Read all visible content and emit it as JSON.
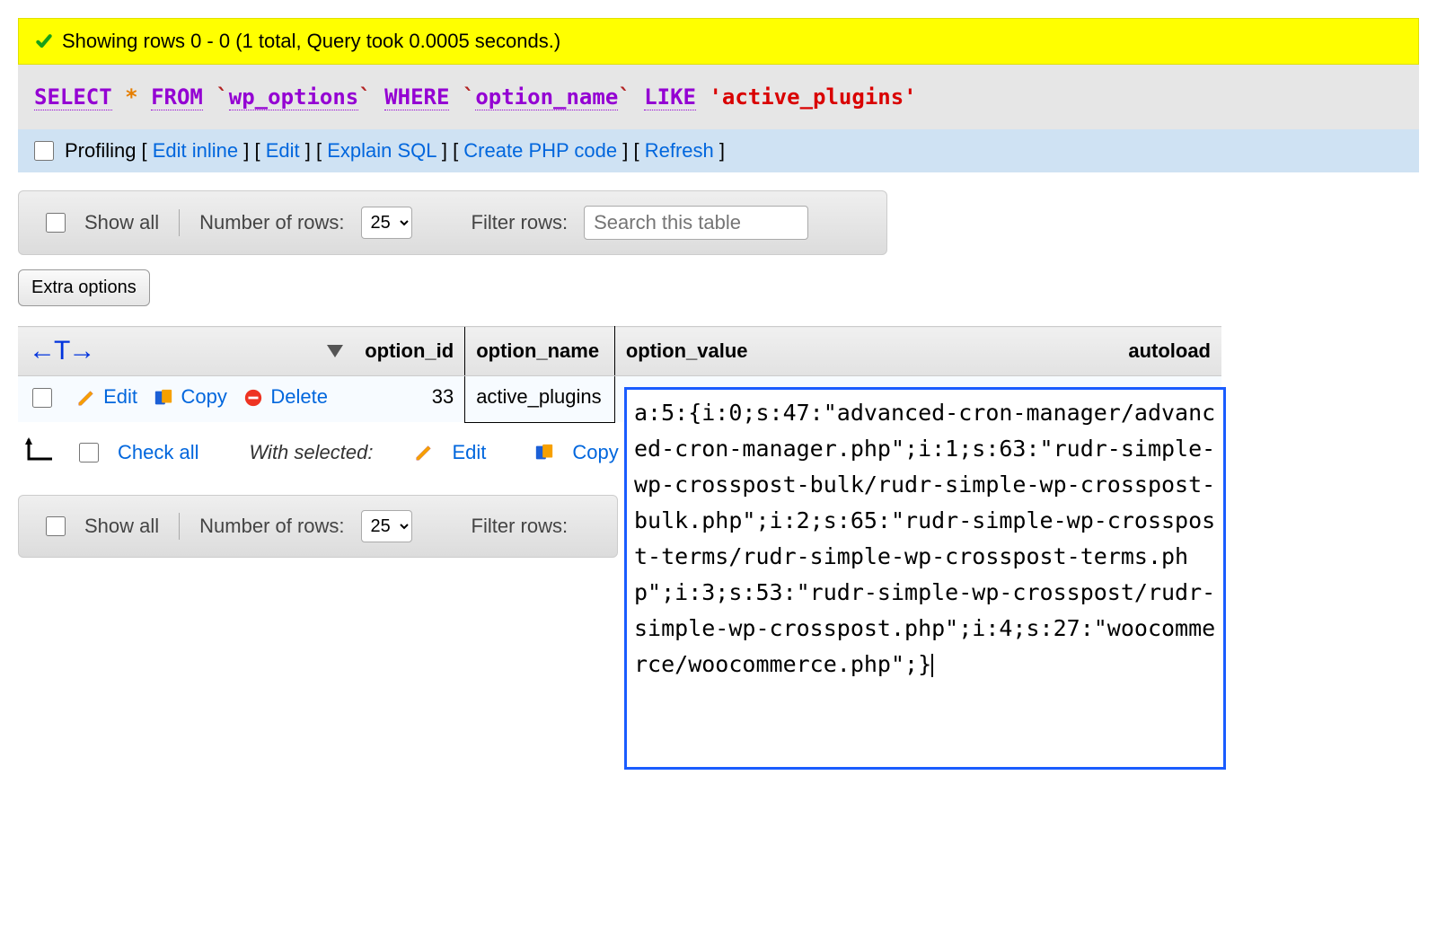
{
  "status": {
    "message": "Showing rows 0 - 0 (1 total, Query took 0.0005 seconds.)"
  },
  "sql": {
    "kw_select": "SELECT",
    "star": "*",
    "kw_from": "FROM",
    "table": "wp_options",
    "kw_where": "WHERE",
    "column": "option_name",
    "kw_like": "LIKE",
    "value": "'active_plugins'"
  },
  "actions": {
    "profiling": "Profiling",
    "edit_inline": "Edit inline",
    "edit": "Edit",
    "explain": "Explain SQL",
    "create_php": "Create PHP code",
    "refresh": "Refresh"
  },
  "controls": {
    "show_all": "Show all",
    "num_rows_label": "Number of rows:",
    "num_rows_value": "25",
    "filter_label": "Filter rows:",
    "filter_placeholder": "Search this table"
  },
  "extra_options": "Extra options",
  "table": {
    "headers": {
      "option_id": "option_id",
      "option_name": "option_name",
      "option_value": "option_value",
      "autoload": "autoload"
    },
    "row": {
      "edit": "Edit",
      "copy": "Copy",
      "delete": "Delete",
      "option_id": "33",
      "option_name": "active_plugins",
      "option_value": "a:5:{i:0;s:47:\"advanced-cron-manager/advanced-cron-manager.php\";i:1;s:63:\"rudr-simple-wp-crosspost-bulk/rudr-simple-wp-crosspost-bulk.php\";i:2;s:65:\"rudr-simple-wp-crosspost-terms/rudr-simple-wp-crosspost-terms.php\";i:3;s:53:\"rudr-simple-wp-crosspost/rudr-simple-wp-crosspost.php\";i:4;s:27:\"woocommerce/woocommerce.php\";}"
    }
  },
  "bulk": {
    "check_all": "Check all",
    "with_selected": "With selected:",
    "edit": "Edit",
    "copy": "Copy"
  }
}
